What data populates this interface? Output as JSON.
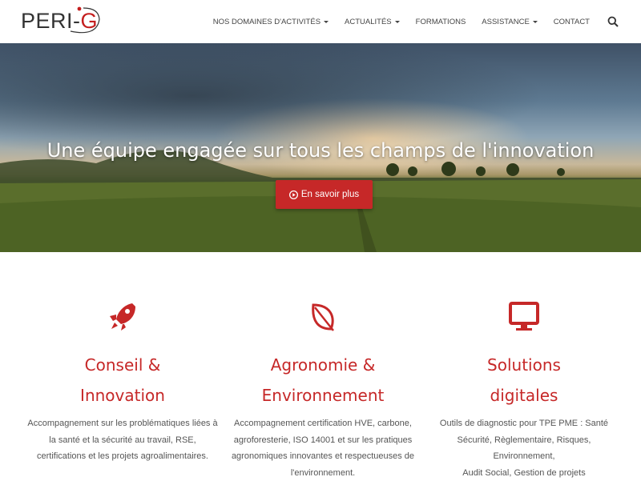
{
  "header": {
    "logo_text_left": "PERI",
    "logo_text_right": "G",
    "nav": [
      {
        "label": "NOS DOMAINES D'ACTIVITÉS",
        "dropdown": true
      },
      {
        "label": "ACTUALITÉS",
        "dropdown": true
      },
      {
        "label": "FORMATIONS",
        "dropdown": false
      },
      {
        "label": "ASSISTANCE",
        "dropdown": true
      },
      {
        "label": "CONTACT",
        "dropdown": false
      }
    ],
    "search_icon": "search-icon"
  },
  "hero": {
    "title": "Une équipe engagée sur tous les champs de l'innovation",
    "button_label": "En savoir plus",
    "button_icon": "play-circle-icon"
  },
  "services": [
    {
      "icon": "rocket-icon",
      "title_line1": "Conseil &",
      "title_line2": "Innovation",
      "desc_lines": [
        "Accompagnement sur les problématiques liées à",
        "la santé et la sécurité au travail, RSE,",
        "certifications et les projets agroalimentaires."
      ]
    },
    {
      "icon": "leaf-icon",
      "title_line1": "Agronomie &",
      "title_line2": "Environnement",
      "desc_lines": [
        "Accompagnement certification HVE, carbone,",
        "agroforesterie, ISO 14001 et sur les pratiques",
        "agronomiques innovantes et respectueuses de",
        "l'environnement."
      ]
    },
    {
      "icon": "monitor-icon",
      "title_line1": "Solutions",
      "title_line2": "digitales",
      "desc_lines": [
        "Outils de diagnostic pour TPE PME : Santé",
        "Sécurité, Règlementaire, Risques, Environnement,",
        "Audit Social, Gestion de projets"
      ]
    }
  ],
  "colors": {
    "accent": "#c62828",
    "text": "#555555",
    "nav_text": "#444444"
  }
}
